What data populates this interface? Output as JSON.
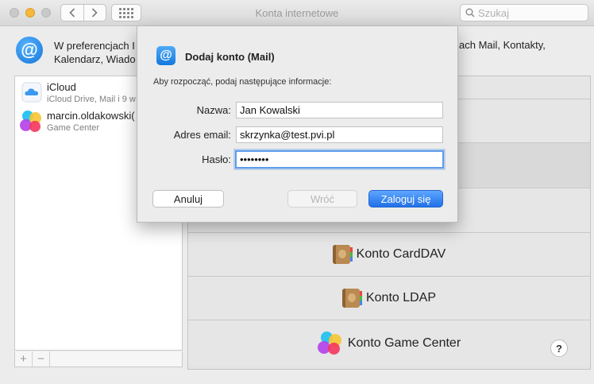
{
  "window": {
    "title": "Konta internetowe",
    "search_placeholder": "Szukaj"
  },
  "header": {
    "text_left_line1": "W preferencjach I",
    "text_left_line2": "Kalendarz, Wiado",
    "text_right": "ach Mail, Kontakty,"
  },
  "accounts": [
    {
      "title": "iCloud",
      "subtitle": "iCloud Drive, Mail i 9 w",
      "icon": "icloud-icon"
    },
    {
      "title": "marcin.oldakowski(",
      "subtitle": "Game Center",
      "icon": "game-center-icon"
    }
  ],
  "list_controls": {
    "add": "+",
    "remove": "−"
  },
  "providers": [
    {
      "label": "Konto CardDAV",
      "icon": "contacts-book-icon"
    },
    {
      "label": "Konto LDAP",
      "icon": "contacts-book-icon"
    },
    {
      "label": "Konto Game Center",
      "icon": "game-center-icon"
    }
  ],
  "help": "?",
  "dialog": {
    "title": "Dodaj konto (Mail)",
    "info": "Aby rozpocząć, podaj następujące informacje:",
    "fields": {
      "name_label": "Nazwa:",
      "name_value": "Jan Kowalski",
      "email_label": "Adres email:",
      "email_value": "skrzynka@test.pvi.pl",
      "password_label": "Hasło:",
      "password_value": "12345678"
    },
    "buttons": {
      "cancel": "Anuluj",
      "back": "Wróć",
      "login": "Zaloguj się"
    }
  },
  "colors": {
    "accent": "#2170e6",
    "focus_ring": "#5e9ce8"
  }
}
